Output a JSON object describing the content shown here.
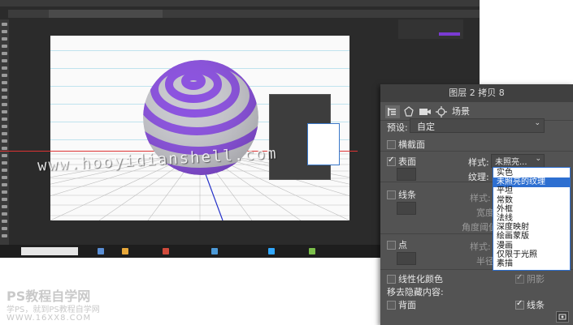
{
  "photoshop_background": {
    "window_title": "",
    "document_tab": "",
    "watermark_url": "www.hooyidianshell.com",
    "taskbar_search": "",
    "mini_panel_options": [
      "",
      "",
      "",
      "",
      "",
      "",
      "",
      "",
      ""
    ]
  },
  "watermark": {
    "brand": "PS教程自学网",
    "subtitle": "学PS，就到PS教程自学网",
    "site": "WWW.16XX8.COM"
  },
  "panel": {
    "title": "图层 2 拷贝 8",
    "tabs": {
      "scene_label": "场景"
    },
    "preset": {
      "label": "预设:",
      "value": "自定"
    },
    "cross_section": {
      "label": "横截面",
      "checked": false
    },
    "surface": {
      "label": "表面",
      "checked": true,
      "style_label": "样式:",
      "style_value": "未照亮...",
      "texture_label": "纹理:"
    },
    "lines": {
      "label": "线条",
      "checked": false,
      "style_label": "样式:",
      "width_label": "宽度:",
      "angle_label": "角度阈值:"
    },
    "points": {
      "label": "点",
      "checked": false,
      "style_label": "样式:",
      "radius_label": "半径:"
    },
    "linearize_colors": {
      "label": "线性化颜色",
      "checked": false
    },
    "shadow": {
      "label": "阴影",
      "checked": true
    },
    "remove_hidden": {
      "label": "移去隐藏内容:"
    },
    "back": {
      "label": "背面",
      "checked": false
    },
    "lines_bottom": {
      "label": "线条",
      "checked": true
    },
    "style_options": [
      "实色",
      "未照亮的纹理",
      "平坦",
      "常数",
      "外框",
      "法线",
      "深度映射",
      "绘画蒙版",
      "漫画",
      "仅限于光照",
      "素描"
    ],
    "selected_style_index": 1
  },
  "colors": {
    "sphere_purple": "#8a4fe0",
    "sphere_gray": "#c9c9cf",
    "panel_bg": "#535353",
    "selection_blue": "#2d6fd1"
  }
}
